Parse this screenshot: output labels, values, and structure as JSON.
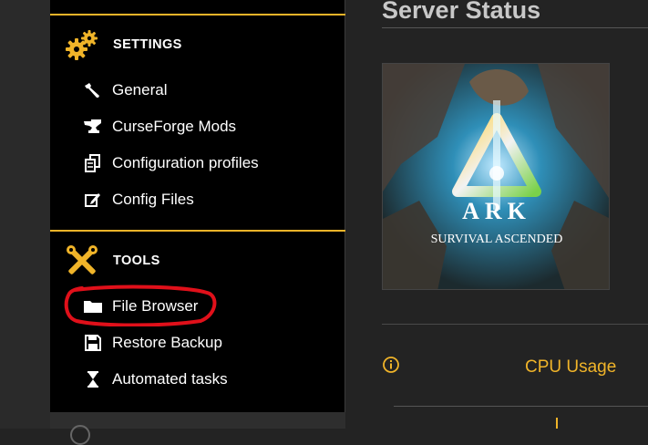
{
  "sidebar": {
    "sections": {
      "settings": {
        "title": "SETTINGS",
        "icon": "gears-icon",
        "items": [
          {
            "label": "General",
            "icon": "wrench-icon"
          },
          {
            "label": "CurseForge Mods",
            "icon": "anvil-icon"
          },
          {
            "label": "Configuration profiles",
            "icon": "copy-icon"
          },
          {
            "label": "Config Files",
            "icon": "edit-icon"
          }
        ]
      },
      "tools": {
        "title": "TOOLS",
        "icon": "tools-icon",
        "items": [
          {
            "label": "File Browser",
            "icon": "folder-icon",
            "highlighted": true
          },
          {
            "label": "Restore Backup",
            "icon": "save-icon"
          },
          {
            "label": "Automated tasks",
            "icon": "hourglass-icon"
          }
        ]
      }
    }
  },
  "main": {
    "title": "Server Status",
    "game_image": {
      "logo_text": "ARK",
      "subtitle": "SURVIVAL ASCENDED"
    },
    "cpu_label": "CPU Usage"
  },
  "colors": {
    "accent": "#f0b429",
    "highlight_ring": "#e0101a",
    "sidebar_bg": "#000000",
    "main_bg": "#232323"
  }
}
